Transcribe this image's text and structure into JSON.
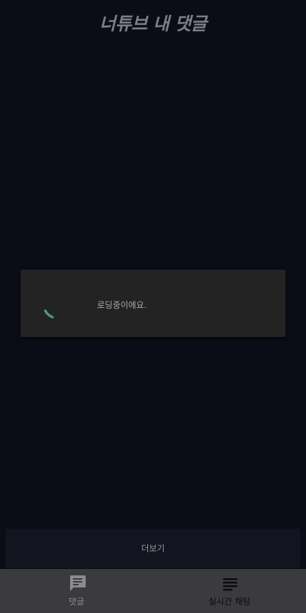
{
  "header": {
    "title": "너튜브 내 댓글"
  },
  "dialog": {
    "message": "로딩중이에요."
  },
  "more_button": {
    "label": "더보기"
  },
  "bottom_nav": {
    "items": [
      {
        "label": "댓글",
        "icon": "comment-icon",
        "active": false
      },
      {
        "label": "실시간 채팅",
        "icon": "lines-icon",
        "active": true
      }
    ]
  },
  "colors": {
    "background": "#0a0d16",
    "dialog": "#232323",
    "spinner": "#4b9a86",
    "nav_bar": "#3b3b3e"
  }
}
